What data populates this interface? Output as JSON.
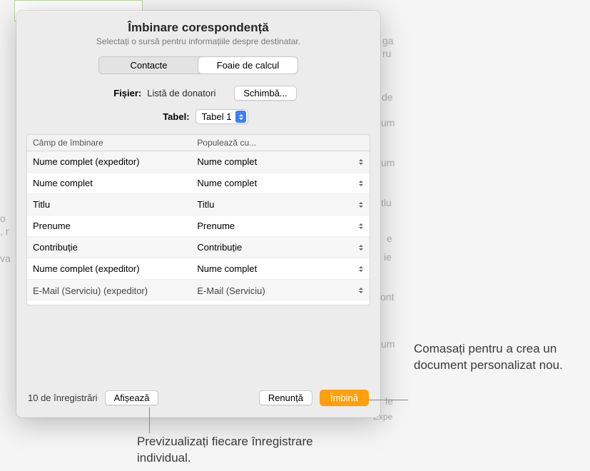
{
  "dialog": {
    "title": "Îmbinare corespondență",
    "subtitle": "Selectați o sursă pentru informațiile despre destinatar."
  },
  "segmented": {
    "contacts": "Contacte",
    "spreadsheet": "Foaie de calcul"
  },
  "file_row": {
    "label": "Fișier:",
    "value": "Listă de donatori",
    "change": "Schimbă..."
  },
  "table_row": {
    "label": "Tabel:",
    "value": "Tabel 1"
  },
  "columns": {
    "merge_field": "Câmp de îmbinare",
    "populate_with": "Populează cu..."
  },
  "rows": [
    {
      "field": "Nume complet (expeditor)",
      "populate": "Nume complet"
    },
    {
      "field": "Nume complet",
      "populate": "Nume complet"
    },
    {
      "field": "Titlu",
      "populate": "Titlu"
    },
    {
      "field": "Prenume",
      "populate": "Prenume"
    },
    {
      "field": "Contribuție",
      "populate": "Contribuție"
    },
    {
      "field": "Nume complet (expeditor)",
      "populate": "Nume complet"
    },
    {
      "field": "E-Mail (Serviciu) (expeditor)",
      "populate": "E-Mail (Serviciu)"
    }
  ],
  "footer": {
    "records": "10 de înregistrări",
    "preview": "Afișează",
    "cancel": "Renunță",
    "merge": "Îmbină"
  },
  "annotations": {
    "merge_hint": "Comasați pentru a crea un document personalizat nou.",
    "preview_hint": "Previzualizați fiecare înregistrare individual."
  },
  "bg": {
    "snips": [
      "ga",
      "ru",
      "de",
      "um",
      "um",
      "tlu",
      "e",
      "ie",
      "ont",
      "um",
      "le",
      "Expe"
    ]
  }
}
